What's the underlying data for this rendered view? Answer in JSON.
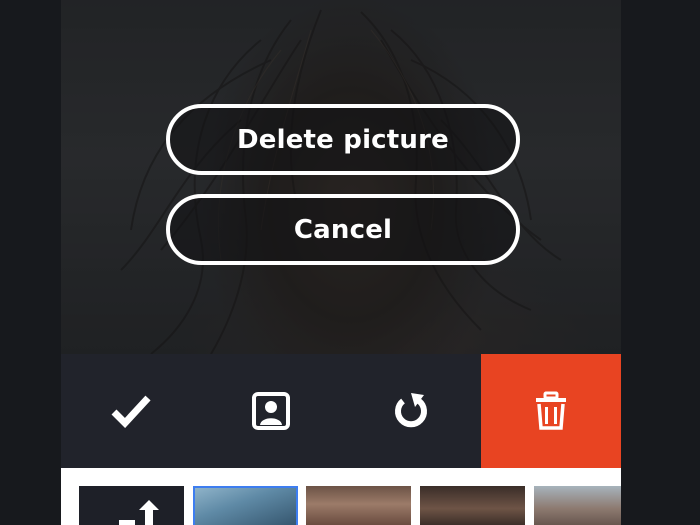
{
  "dialog": {
    "delete_label": "Delete picture",
    "cancel_label": "Cancel"
  },
  "toolbar": {
    "items": [
      {
        "icon": "checkmark-icon"
      },
      {
        "icon": "portrait-icon"
      },
      {
        "icon": "rotate-icon"
      },
      {
        "icon": "trash-icon"
      }
    ],
    "delete_color": "#e84422",
    "background_color": "#21232b"
  },
  "thumbnails": {
    "selected_border_color": "#3d7df0",
    "items": [
      {
        "kind": "add-photo"
      },
      {
        "kind": "photo",
        "selected": true
      },
      {
        "kind": "photo",
        "selected": false
      },
      {
        "kind": "photo",
        "selected": false
      },
      {
        "kind": "photo",
        "selected": false
      }
    ]
  }
}
